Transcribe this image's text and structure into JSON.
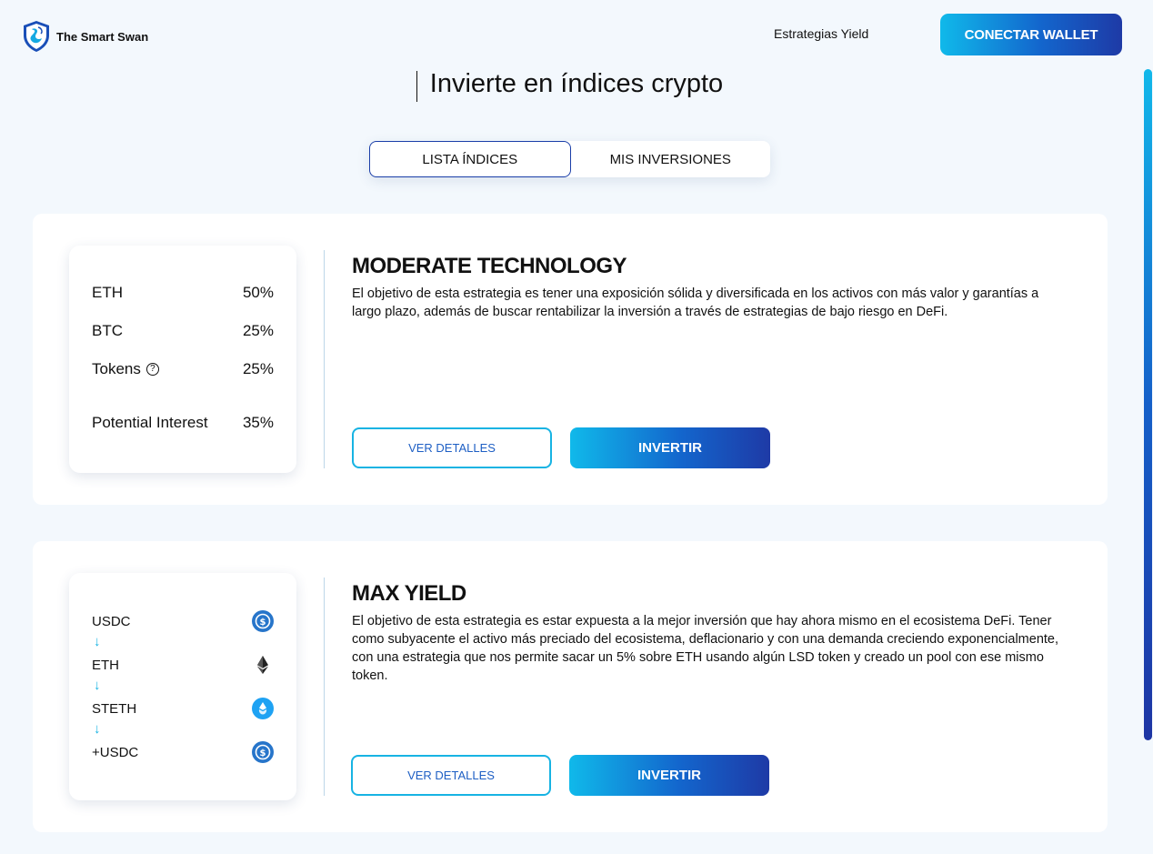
{
  "header": {
    "brand": "The Smart Swan",
    "nav_link": "Estrategias Yield",
    "connect_label": "CONECTAR WALLET"
  },
  "page_title": "Invierte en índices crypto",
  "tabs": [
    {
      "label": "LISTA ÍNDICES",
      "active": true
    },
    {
      "label": "MIS INVERSIONES",
      "active": false
    }
  ],
  "strategies": [
    {
      "title": "MODERATE TECHNOLOGY",
      "description": "El objetivo de esta estrategia es tener una exposición sólida y diversificada en los activos con más valor y garantías a largo plazo, además de buscar rentabilizar la inversión a través de estrategias de bajo riesgo en DeFi.",
      "allocation": [
        {
          "label": "ETH",
          "value": "50%"
        },
        {
          "label": "BTC",
          "value": "25%"
        },
        {
          "label": "Tokens",
          "value": "25%"
        },
        {
          "label": "Potential Interest",
          "value": "35%"
        }
      ],
      "details_label": "VER DETALLES",
      "invest_label": "INVERTIR"
    },
    {
      "title": "MAX YIELD",
      "description": "El objetivo de esta estrategia es estar expuesta a la mejor inversión que hay ahora mismo en el ecosistema DeFi. Tener como subyacente el activo más preciado del ecosistema, deflacionario y con una demanda creciendo exponencialmente, con una estrategia que nos permite sacar un 5% sobre ETH usando algún LSD token y creado un pool con ese mismo token.",
      "flow": [
        {
          "label": "USDC",
          "icon": "usdc-icon"
        },
        {
          "label": "ETH",
          "icon": "eth-icon"
        },
        {
          "label": "STETH",
          "icon": "steth-icon"
        },
        {
          "label": "+USDC",
          "icon": "usdc-icon"
        }
      ],
      "arrow": "↓",
      "details_label": "VER DETALLES",
      "invest_label": "INVERTIR"
    }
  ],
  "colors": {
    "accent_start": "#10b9ea",
    "accent_end": "#1e3aa6",
    "background": "#f3f8fd"
  }
}
